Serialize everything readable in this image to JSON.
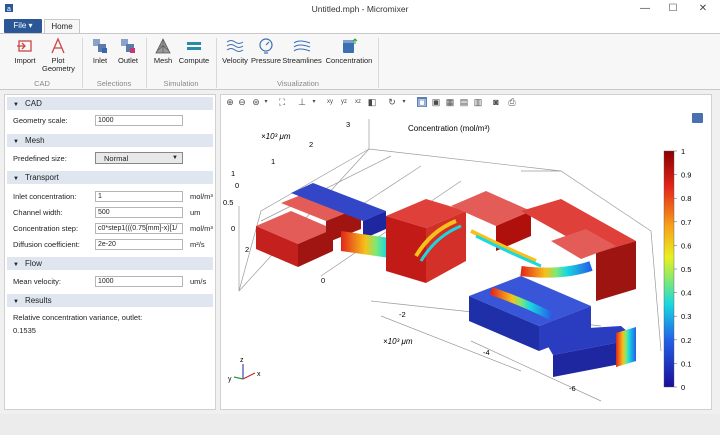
{
  "window": {
    "title": "Untitled.mph - Micromixer",
    "minimize": "—",
    "maximize": "☐",
    "close": "✕"
  },
  "tabs": {
    "file": "File ▾",
    "home": "Home"
  },
  "ribbon": {
    "buttons": {
      "import": "Import",
      "plot_geometry_1": "Plot",
      "plot_geometry_2": "Geometry",
      "inlet": "Inlet",
      "outlet": "Outlet",
      "mesh": "Mesh",
      "compute": "Compute",
      "velocity": "Velocity",
      "pressure": "Pressure",
      "streamlines": "Streamlines",
      "concentration": "Concentration"
    },
    "groups": {
      "cad": "CAD",
      "selections": "Selections",
      "simulation": "Simulation",
      "visualization": "Visualization"
    }
  },
  "panel": {
    "cad": {
      "header": "CAD",
      "geometry_scale_label": "Geometry scale:",
      "geometry_scale": "1000"
    },
    "mesh": {
      "header": "Mesh",
      "predefined_size_label": "Predefined size:",
      "predefined_size": "Normal"
    },
    "transport": {
      "header": "Transport",
      "inlet_conc_label": "Inlet concentration:",
      "inlet_conc": "1",
      "inlet_conc_unit": "mol/m³",
      "channel_width_label": "Channel width:",
      "channel_width": "500",
      "channel_width_unit": "um",
      "conc_step_label": "Concentration step:",
      "conc_step": "c0*step1(((0.75[mm]-x)[1/",
      "conc_step_unit": "mol/m³",
      "diffusion_label": "Diffusion coefficient:",
      "diffusion": "2e-20",
      "diffusion_unit": "m²/s"
    },
    "flow": {
      "header": "Flow",
      "mean_velocity_label": "Mean velocity:",
      "mean_velocity": "1000",
      "mean_velocity_unit": "um/s"
    },
    "results": {
      "header": "Results",
      "variance_label": "Relative concentration variance, outlet:",
      "variance_value": "0.1535"
    }
  },
  "plot": {
    "title": "Concentration (mol/m³)",
    "axis_unit_top": "×10³ μm",
    "axis_unit_bottom": "×10³ μm",
    "z_ticks": [
      "1",
      "0.5",
      "0"
    ],
    "y_ticks": [
      "3",
      "2",
      "1",
      "0"
    ],
    "left_ticks": [
      "2",
      "0"
    ],
    "x_ticks": [
      "-2",
      "-4",
      "-6"
    ],
    "colorbar_ticks": [
      "1",
      "0.9",
      "0.8",
      "0.7",
      "0.6",
      "0.5",
      "0.4",
      "0.3",
      "0.2",
      "0.1",
      "0"
    ],
    "triad": {
      "z": "z",
      "y": "y",
      "x": "x"
    }
  }
}
